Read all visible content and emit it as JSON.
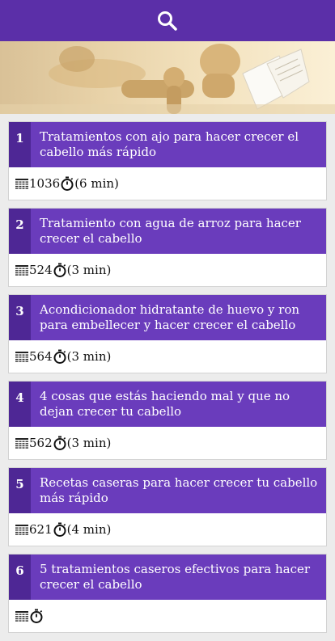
{
  "header": {
    "search_icon": "search-icon"
  },
  "colors": {
    "bar": "#5b2fa8",
    "card_header": "#6a3cbc",
    "number_cell": "#4e2795"
  },
  "articles": [
    {
      "number": "1",
      "title": "Tratamientos con ajo para hacer crecer el cabello más rápido",
      "words": "1036",
      "time": "(6 min)"
    },
    {
      "number": "2",
      "title": "Tratamiento con agua de arroz para hacer crecer el cabello",
      "words": "524",
      "time": "(3 min)"
    },
    {
      "number": "3",
      "title": "Acondicionador hidratante de huevo y ron para embellecer y hacer crecer el cabello",
      "words": "564",
      "time": "(3 min)"
    },
    {
      "number": "4",
      "title": "4 cosas que estás haciendo mal y que no dejan crecer tu cabello",
      "words": "562",
      "time": "(3 min)"
    },
    {
      "number": "5",
      "title": "Recetas caseras para hacer crecer tu cabello más rápido",
      "words": "621",
      "time": "(4 min)"
    },
    {
      "number": "6",
      "title": "5 tratamientos caseros efectivos para hacer crecer el cabello",
      "words": "",
      "time": ""
    }
  ]
}
